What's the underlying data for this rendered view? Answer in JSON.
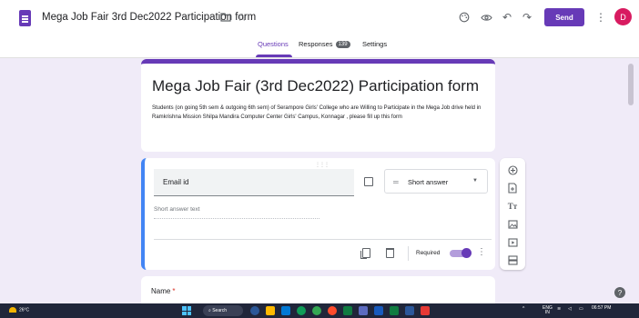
{
  "header": {
    "form_title": "Mega Job Fair 3rd Dec2022 Participation form",
    "send_label": "Send",
    "avatar_initial": "D",
    "icons": [
      "folder-icon",
      "star-icon",
      "palette-icon",
      "eye-icon",
      "undo-icon",
      "redo-icon",
      "more-vert-icon"
    ]
  },
  "tabs": {
    "questions": "Questions",
    "responses": "Responses",
    "responses_count": "139",
    "settings": "Settings"
  },
  "title_card": {
    "title": "Mega Job Fair (3rd Dec2022) Participation form",
    "description": "Students (on going 5th sem & outgoing 6th sem) of Serampore Girls' College who are Willing to Participate in the Mega Job drive held in Ramkrishna Mission Shilpa Mandira Computer Center Girls' Campus, Konnagar , please fill up this form"
  },
  "question": {
    "title": "Email id",
    "type": "Short answer",
    "answer_placeholder": "Short answer text",
    "required_label": "Required",
    "required": true
  },
  "next_question": {
    "title": "Name",
    "required_mark": "*"
  },
  "taskbar": {
    "weather": "26°C",
    "search": "Search",
    "lang": "ENG",
    "region": "IN",
    "time": "06:57 PM"
  },
  "colors": {
    "accent": "#673ab7",
    "focus": "#4285f4",
    "background": "#f0ebf8"
  }
}
